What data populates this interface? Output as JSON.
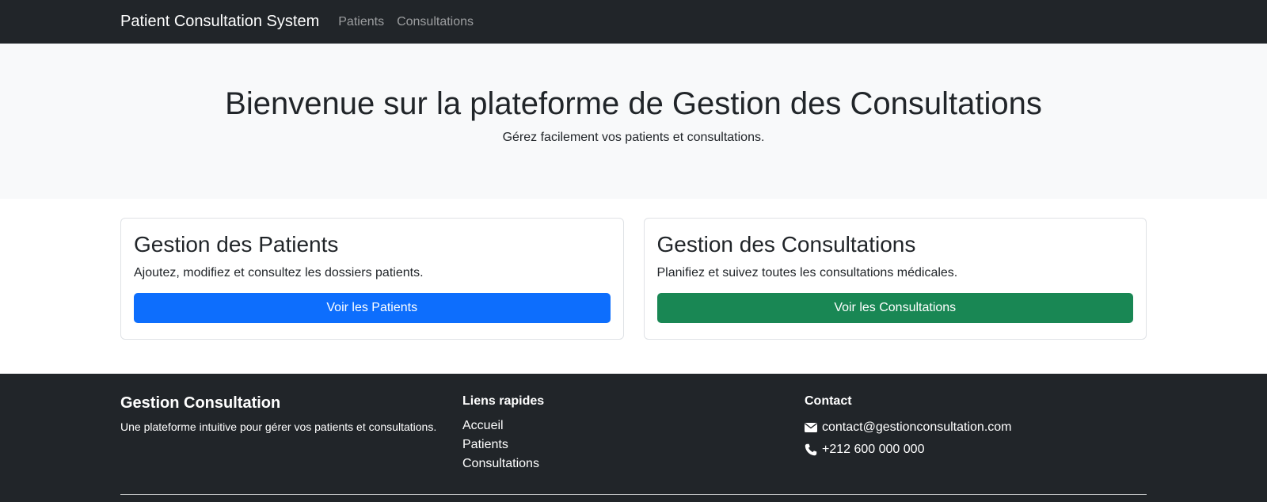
{
  "navbar": {
    "brand": "Patient Consultation System",
    "links": [
      "Patients",
      "Consultations"
    ]
  },
  "hero": {
    "title": "Bienvenue sur la plateforme de Gestion des Consultations",
    "subtitle": "Gérez facilement vos patients et consultations."
  },
  "cards": [
    {
      "title": "Gestion des Patients",
      "text": "Ajoutez, modifiez et consultez les dossiers patients.",
      "button": "Voir les Patients",
      "button_color": "#0d6efd"
    },
    {
      "title": "Gestion des Consultations",
      "text": "Planifiez et suivez toutes les consultations médicales.",
      "button": "Voir les Consultations",
      "button_color": "#198754"
    }
  ],
  "footer": {
    "about_title": "Gestion Consultation",
    "about_text": "Une plateforme intuitive pour gérer vos patients et consultations.",
    "links_title": "Liens rapides",
    "links": [
      "Accueil",
      "Patients",
      "Consultations"
    ],
    "contact_title": "Contact",
    "email": "contact@gestionconsultation.com",
    "email_icon": "envelope-icon",
    "phone": "+212 600 000 000",
    "phone_icon": "phone-icon"
  },
  "colors": {
    "navbar_bg": "#212529",
    "hero_bg": "#f8f9fa",
    "primary": "#0d6efd",
    "success": "#198754"
  }
}
